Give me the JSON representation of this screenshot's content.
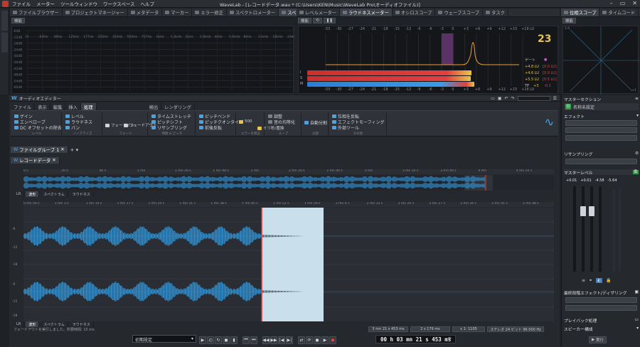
{
  "app": {
    "window_title": "WaveLab - [レコードデータ.wav * (C:\\Users\\KEN\\Music\\WaveLab Pro\\オーディオファイル)]",
    "menu": [
      "ファイル",
      "メーター",
      "ツールウィンドウ",
      "ワークスペース",
      "ヘルプ"
    ]
  },
  "top_left_panel": {
    "tabs": [
      "ファイルブラウザー",
      "プロジェクトマネージャー",
      "メタデータ",
      "マーカー",
      "エラー修正",
      "スペクトロメーター",
      "スペクトロスコープ"
    ],
    "active_tab": "スペクトロスコープ",
    "mode_label": "機能",
    "y_labels": [
      "-6dB",
      "-12dB",
      "-18dB",
      "-24dB",
      "-30dB",
      "-36dB",
      "-42dB",
      "-48dB",
      "-54dB",
      "-60dB"
    ],
    "x_labels": [
      "31",
      "63Hz",
      "89Hz",
      "125Hz",
      "177Hz",
      "250Hz",
      "354Hz",
      "500Hz",
      "707Hz",
      "1kHz",
      "1.4kHz",
      "2kHz",
      "2.8kHz",
      "4kHz",
      "5.6kHz",
      "8kHz",
      "11kHz",
      "16kHz",
      "23kHz"
    ]
  },
  "top_mid_panel": {
    "tabs": [
      "レベルメーター",
      "ラウドネスメーター",
      "オシロスコープ",
      "ウェーブスコープ",
      "タスク"
    ],
    "active_tab": "ラウドネスメーター",
    "mode_label": "機能",
    "scale": [
      "-33",
      "-30",
      "-27",
      "-24",
      "-21",
      "-18",
      "-15",
      "-12",
      "-9",
      "-6",
      "-3",
      "0",
      "+3",
      "+6",
      "+9",
      "+12",
      "+15",
      "+18 LU"
    ],
    "rows": [
      {
        "label": "ゲート",
        "value": "",
        "color": "#c060c0"
      },
      {
        "label": "I",
        "value": "+4.8 LU",
        "neg": "[0.0 LU]"
      },
      {
        "label": "S",
        "value": "+4.6 LU",
        "neg": "[0.0 LU]"
      },
      {
        "label": "M",
        "value": "+5.5 LU",
        "neg": "[0.5 LU]"
      },
      {
        "label": "TP",
        "value": "+3",
        "neg": "-0.1"
      }
    ],
    "bar_levels_lu": {
      "I": 4.8,
      "S": 4.6,
      "M": 5.5
    },
    "logo": "23"
  },
  "top_right_panel": {
    "tabs": [
      "位相スコープ",
      "タイムコード"
    ],
    "active_tab": "位相スコープ",
    "mode_label": "機能",
    "corner": "1:0",
    "corner_r": "+1"
  },
  "editor": {
    "title": "オーディオエディター",
    "ribbon_tabs": [
      "ファイル",
      "表示",
      "編集",
      "挿入",
      "処理",
      "検出",
      "レンダリング"
    ],
    "active_ribbon_tab": "処理",
    "groups": [
      {
        "items": [
          "ゲイン",
          "エンベロープ",
          "DC オフセットの除去"
        ],
        "label": "レベル"
      },
      {
        "items": [
          "レベル",
          "ラウドネス",
          "パン"
        ],
        "label": "ノーマライズ"
      },
      {
        "items": [
          "フェードイン",
          "フェードアウト"
        ],
        "label": "フェード"
      },
      {
        "items": [
          "タイムストレッチ",
          "ピッチシフト",
          "リサンプリング"
        ],
        "label": "時間 & ピッチ"
      },
      {
        "items": [
          "ピッチベンド",
          "ピッチクオンタイズ",
          "前後反転"
        ],
        "label": ""
      },
      {
        "items": [
          "500",
          "ミリ秒/置換"
        ],
        "label": "エラーを修正"
      },
      {
        "items": [
          "調整",
          "音の均等化"
        ],
        "label": "ループ"
      },
      {
        "items": [
          "自動分割"
        ],
        "label": "分割"
      },
      {
        "items": [
          "位相を反転",
          "エフェクトモーフィング",
          "外部ツール"
        ],
        "label": "その他"
      }
    ],
    "file_group_tab": "ファイルグループ 1",
    "file_tab": "レコードデータ",
    "overview_ruler": [
      "0 s",
      "20 s",
      "40 s",
      "1 mn",
      "1 mn 20 s",
      "1 mn 40 s",
      "2 mn",
      "2 mn 20 s",
      "2 mn 40 s",
      "3 mn",
      "3 mn 20 s",
      "3 mn 40 s",
      "4 mn",
      "4 mn 20 s"
    ],
    "main_ruler": [
      "0 mn 56 s",
      "1 mn 3 s",
      "1 mn 10 s",
      "1 mn 17 s",
      "1 mn 24 s",
      "1 mn 31 s",
      "1 mn 38 s",
      "1 mn 45 s",
      "1 mn 52 s",
      "1 mn 59 s",
      "2 mn 6 s",
      "2 mn 13 s",
      "2 mn 20 s",
      "2 mn 27 s",
      "2 mn 34 s",
      "2 mn 41 s",
      "2 mn 48 s"
    ],
    "view_tabs": [
      "LR",
      "波形",
      "スペクトラム",
      "ラウドネス"
    ],
    "db_labels": [
      "-6",
      "-12",
      "-18",
      "-6",
      "-12",
      "-18"
    ],
    "status_left": "フェードアウトを実行しました。所要時間: 15 ms",
    "status_fields": [
      "3 mn 21 s 453 ms",
      "2 s 179 ms",
      "x 1: 1105",
      "ステレオ 24 ビット 96 000 Hz"
    ],
    "transport_dropdown": "初期設定",
    "timecode": "00 h 03 mn 21 s 453 ms"
  },
  "master": {
    "title": "マスターセクション",
    "preset": "名称未設定",
    "sections": [
      "エフェクト",
      "リサンプリング",
      "マスターレベル",
      "最終段階エフェクト/ディザリング",
      "プレイバック処理",
      "スピーカー構成"
    ],
    "levels": [
      "+0.01",
      "+0.01",
      "-4.58",
      "-5.64"
    ],
    "render_btn": "実行"
  }
}
